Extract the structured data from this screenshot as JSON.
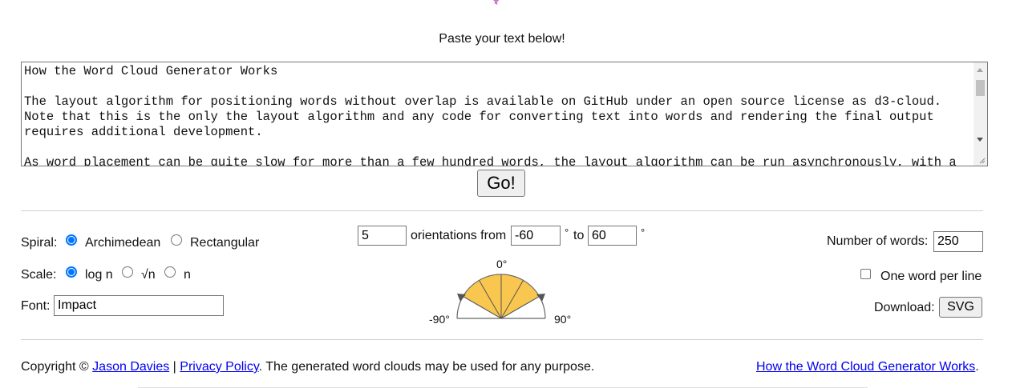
{
  "prompt": "Paste your text below!",
  "textarea": {
    "content": "How the Word Cloud Generator Works\n\nThe layout algorithm for positioning words without overlap is available on GitHub under an open source license as d3-cloud. Note that this is the only the layout algorithm and any code for converting text into words and rendering the final output requires additional development.\n\nAs word placement can be quite slow for more than a few hundred words, the layout algorithm can be run asynchronously, with a configurable time step size."
  },
  "go_label": "Go!",
  "spiral": {
    "label": "Spiral:",
    "options": [
      "Archimedean",
      "Rectangular"
    ],
    "selected": "Archimedean"
  },
  "scale": {
    "label": "Scale:",
    "options": [
      "log n",
      "√n",
      "n"
    ],
    "selected": "log n"
  },
  "font": {
    "label": "Font:",
    "value": "Impact"
  },
  "orientations": {
    "count": "5",
    "text_from": "orientations from",
    "from": "-60",
    "deg1": "°",
    "text_to": "to",
    "to": "60",
    "deg2": "°"
  },
  "dial": {
    "label_top": "0°",
    "label_left": "-90°",
    "label_right": "90°",
    "fill_color": "#f9c74f"
  },
  "words": {
    "label": "Number of words:",
    "value": "250"
  },
  "one_word_per_line": {
    "label": "One word per line",
    "checked": false
  },
  "download": {
    "label": "Download:",
    "button": "SVG"
  },
  "footer": {
    "copyright": "Copyright ©",
    "author_link": "Jason Davies",
    "sep": "|",
    "privacy_link": "Privacy Policy",
    "tail": ". The generated word clouds may be used for any purpose.",
    "how_link": "How the Word Cloud Generator Works",
    "how_tail": "."
  },
  "colors": {
    "accent": "#0075ff",
    "link": "#0000ee",
    "logo": "#c86cc8"
  }
}
